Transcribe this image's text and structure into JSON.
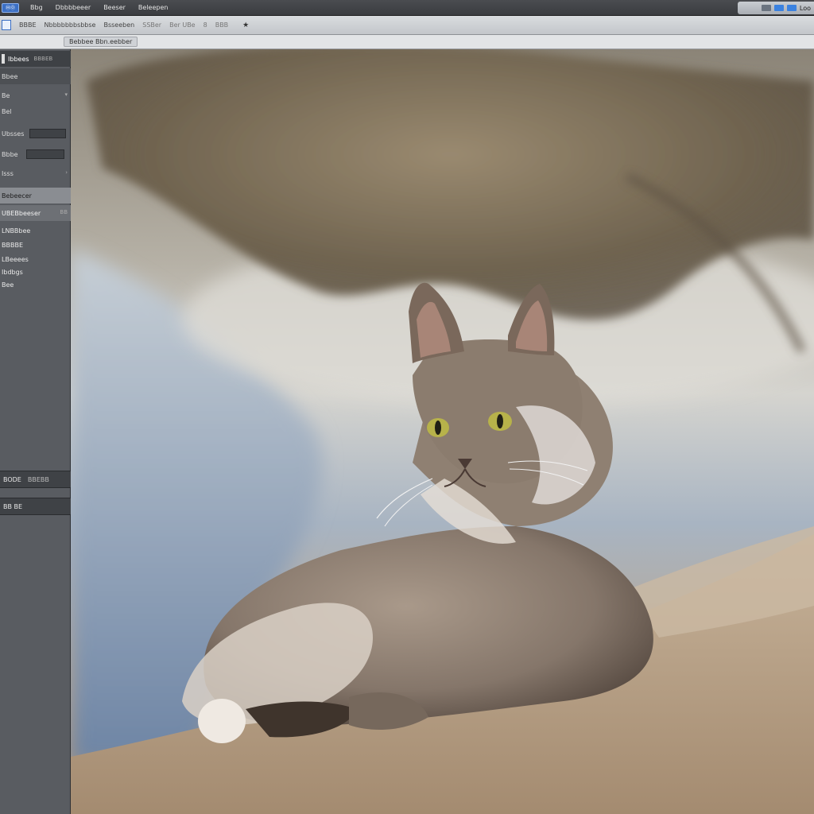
{
  "menubar": {
    "app_badge": "ⓂⓄ",
    "items": [
      "Bbg",
      "Dbbbbeeer",
      "Beeser",
      "Beleepen"
    ],
    "clock": "Loo"
  },
  "toolbar": {
    "labels": [
      "BBBE",
      "Nbbbbbbbsbbse",
      "Bsseeben",
      "SSBer",
      "Ber UBe",
      "8",
      "BBB"
    ],
    "star": "★"
  },
  "optionsbar": {
    "chip_label": "Bebbee Bbn.eebber"
  },
  "leftpanel": {
    "header_title": "Ibbees",
    "header_tag": "BBBEB",
    "rows": [
      "Bbee",
      "Be",
      "Bel",
      "Ubsses",
      "Bbbe",
      "Isss"
    ],
    "highlight_row": "Bebeecer",
    "highlight_row2": "UBEBbeeser",
    "highlight_row2_suffix": "BB",
    "list_items": [
      "LNBBbee",
      "BBBBE",
      "LBeeees",
      "Ibdbgs",
      "Bee"
    ],
    "footer_row_1": "BODE",
    "footer_row_1_btn": "BBEBB",
    "footer_row_2": "BB BE"
  },
  "canvas": {
    "colors": {
      "foliage": "#8d7e66",
      "water": "#8e9db0",
      "sand": "#b59e84",
      "cat_fur": "#8a7a6c",
      "cat_eye": "#b7b24a"
    }
  }
}
